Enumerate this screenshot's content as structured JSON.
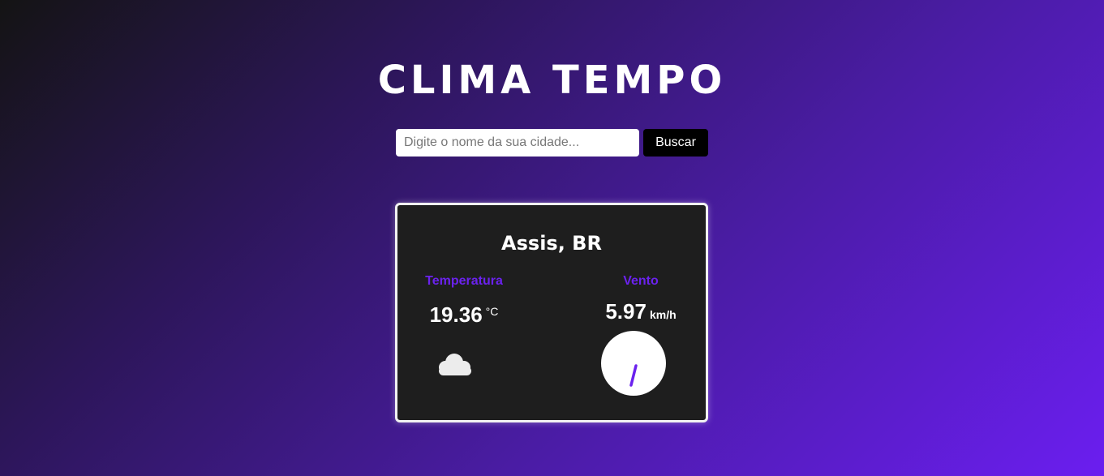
{
  "header": {
    "title": "CLIMA TEMPO"
  },
  "search": {
    "placeholder": "Digite o nome da sua cidade...",
    "value": "",
    "button_label": "Buscar"
  },
  "weather": {
    "city": "Assis, BR",
    "temperature": {
      "label": "Temperatura",
      "value": "19.36",
      "unit": "°C",
      "icon": "cloud-icon"
    },
    "wind": {
      "label": "Vento",
      "value": "5.97",
      "unit": "km/h",
      "icon": "wind-direction-arrow-icon"
    }
  },
  "colors": {
    "accent": "#6b22ee",
    "card_background": "#1e1e1e",
    "button_background": "#000000"
  }
}
